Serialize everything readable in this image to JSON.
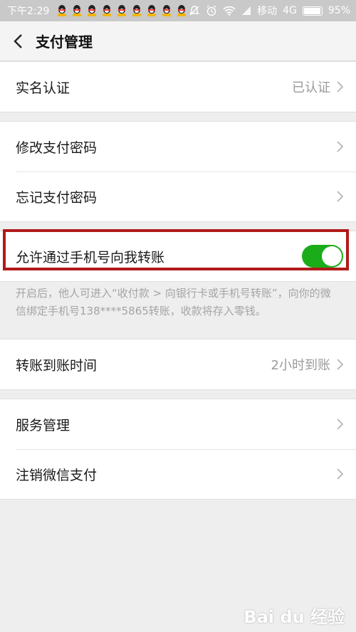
{
  "status": {
    "time": "下午2:29",
    "carrier": "移动",
    "network": "4G",
    "battery": "95%",
    "battery_level": 0.95
  },
  "nav": {
    "title": "支付管理"
  },
  "items": {
    "realname": {
      "label": "实名认证",
      "value": "已认证"
    },
    "change_pwd": {
      "label": "修改支付密码"
    },
    "forget_pwd": {
      "label": "忘记支付密码"
    },
    "allow_phone": {
      "label": "允许通过手机号向我转账",
      "enabled": true
    },
    "allow_phone_desc": "开启后，他人可进入“收付款 > 向银行卡或手机号转账”，向你的微信绑定手机号138****5865转账，收款将存入零钱。",
    "arrival_time": {
      "label": "转账到账时间",
      "value": "2小时到账"
    },
    "service": {
      "label": "服务管理"
    },
    "cancel": {
      "label": "注销微信支付"
    }
  },
  "watermark": "Bai du 经验",
  "colors": {
    "toggle_on": "#1aad19",
    "highlight": "#b11a1a"
  }
}
